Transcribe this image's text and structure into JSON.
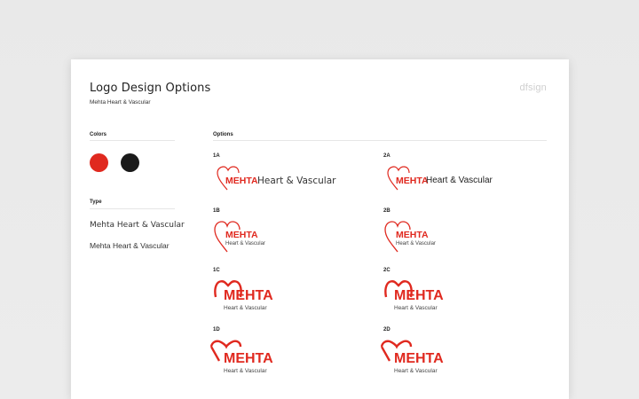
{
  "header": {
    "title": "Logo Design Options",
    "subtitle": "Mehta Heart & Vascular",
    "brand": "dfsign"
  },
  "colors_section": {
    "label": "Colors",
    "swatches": [
      {
        "name": "red",
        "hex": "#e0291f"
      },
      {
        "name": "black",
        "hex": "#1a1a1a"
      }
    ]
  },
  "type_section": {
    "label": "Type",
    "samples": [
      "Mehta Heart & Vascular",
      "Mehta Heart & Vascular"
    ]
  },
  "options_section": {
    "label": "Options",
    "options": [
      {
        "id": "1A",
        "word": "MEHTA",
        "sub": "Heart & Vascular"
      },
      {
        "id": "2A",
        "word": "MEHTA",
        "sub": "Heart & Vascular"
      },
      {
        "id": "1B",
        "word": "MEHTA",
        "sub": "Heart & Vascular"
      },
      {
        "id": "2B",
        "word": "MEHTA",
        "sub": "Heart & Vascular"
      },
      {
        "id": "1C",
        "word": "MEHTA",
        "sub": "Heart & Vascular"
      },
      {
        "id": "2C",
        "word": "MEHTA",
        "sub": "Heart & Vascular"
      },
      {
        "id": "1D",
        "word": "MEHTA",
        "sub": "Heart & Vascular"
      },
      {
        "id": "2D",
        "word": "MEHTA",
        "sub": "Heart & Vascular"
      }
    ]
  }
}
